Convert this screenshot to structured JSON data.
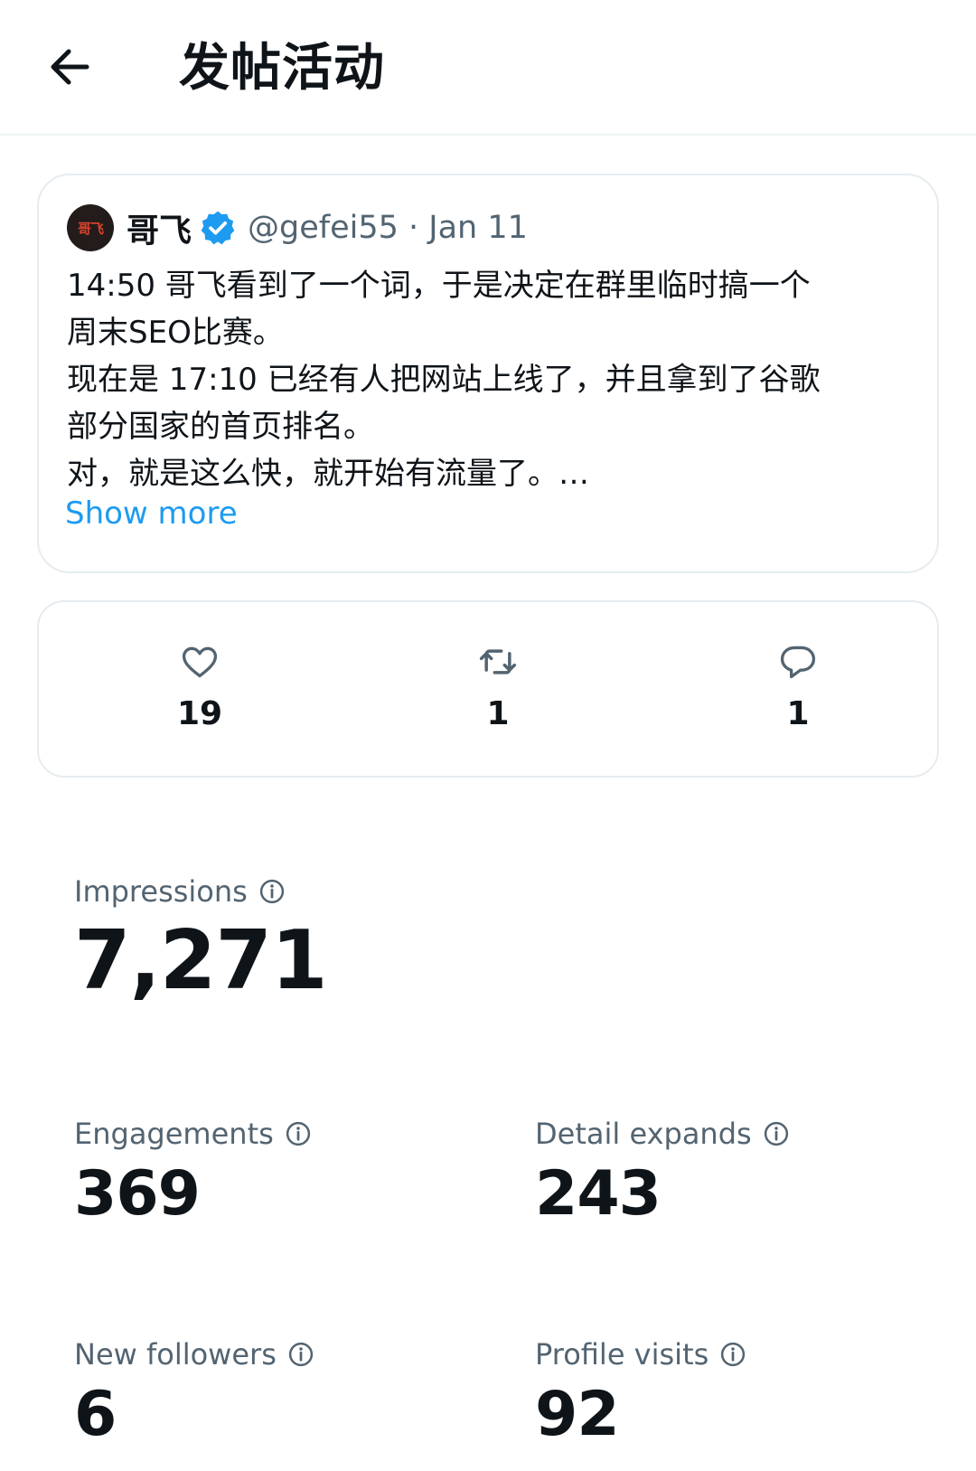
{
  "header": {
    "title": "发帖活动",
    "back_icon": "arrow-left-icon"
  },
  "tweet": {
    "avatar_text": "哥飞",
    "author_name": "哥飞",
    "verified_icon": "verified-badge-icon",
    "verified_color": "#1d9bf0",
    "handle_and_date": "@gefei55 · Jan 11",
    "lines": [
      "14:50 哥飞看到了一个词，于是决定在群里临时搞一个",
      "周末SEO比赛。",
      "现在是 17:10 已经有人把网站上线了，并且拿到了谷歌",
      "部分国家的首页排名。",
      "对，就是这么快，就开始有流量了。…"
    ],
    "show_more": "Show more"
  },
  "counts": {
    "likes": "19",
    "reposts": "1",
    "replies": "1",
    "like_icon": "heart-icon",
    "repost_icon": "repost-icon",
    "reply_icon": "reply-bubble-icon"
  },
  "metrics": {
    "impressions": {
      "label": "Impressions",
      "value": "7,271"
    },
    "engagements": {
      "label": "Engagements",
      "value": "369"
    },
    "detail_expands": {
      "label": "Detail expands",
      "value": "243"
    },
    "new_followers": {
      "label": "New followers",
      "value": "6"
    },
    "profile_visits": {
      "label": "Profile visits",
      "value": "92"
    },
    "info_icon": "info-circle-icon"
  },
  "colors": {
    "accent": "#1d9bf0",
    "text_primary": "#0f1419",
    "text_secondary": "#536471",
    "border": "#e6ecf0"
  }
}
